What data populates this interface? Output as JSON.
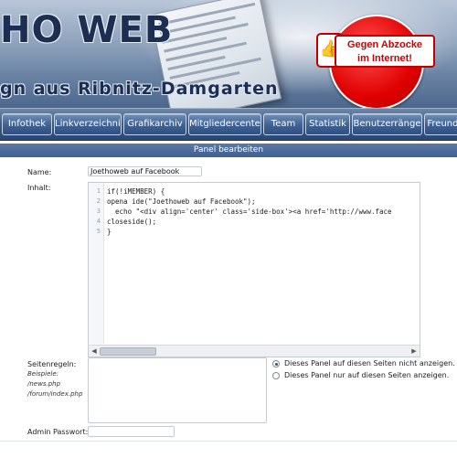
{
  "header": {
    "logo_text": "HO WEB",
    "tagline": "gn aus Ribnitz-Damgarten",
    "badge": {
      "line1": "Gegen Abzocke",
      "line2": "im Internet!"
    }
  },
  "nav": {
    "items": [
      {
        "label": "Infothek"
      },
      {
        "label": "Linkverzeichnis"
      },
      {
        "label": "Grafikarchiv"
      },
      {
        "label": "Mitgliedercenter"
      },
      {
        "label": "Team"
      },
      {
        "label": "Statistik"
      },
      {
        "label": "Benutzerränge"
      },
      {
        "label": "Freunde"
      }
    ]
  },
  "panel": {
    "title": "Panel bearbeiten",
    "name_label": "Name:",
    "name_value": "Joethoweb auf Facebook",
    "content_label": "Inhalt:",
    "code": {
      "line_numbers": [
        "1",
        "2",
        "3",
        "4",
        "5"
      ],
      "lines": [
        "if(!iMEMBER) {",
        "opena ide(\"Joethoweb auf Facebook\");",
        "  echo \"<div align='center' class='side-box'><a href='http://www.face",
        "closeside();",
        "}"
      ]
    },
    "rules_label": "Seitenregeln:",
    "rules_hint_title": "Beispiele:",
    "rules_hint_examples": [
      "/news.php",
      "/forum/index.php"
    ],
    "radio_options": [
      {
        "label": "Dieses Panel auf diesen Seiten nicht anzeigen.",
        "checked": true
      },
      {
        "label": "Dieses Panel nur auf diesen Seiten anzeigen.",
        "checked": false
      }
    ],
    "admin_password_label": "Admin Passwort:"
  }
}
